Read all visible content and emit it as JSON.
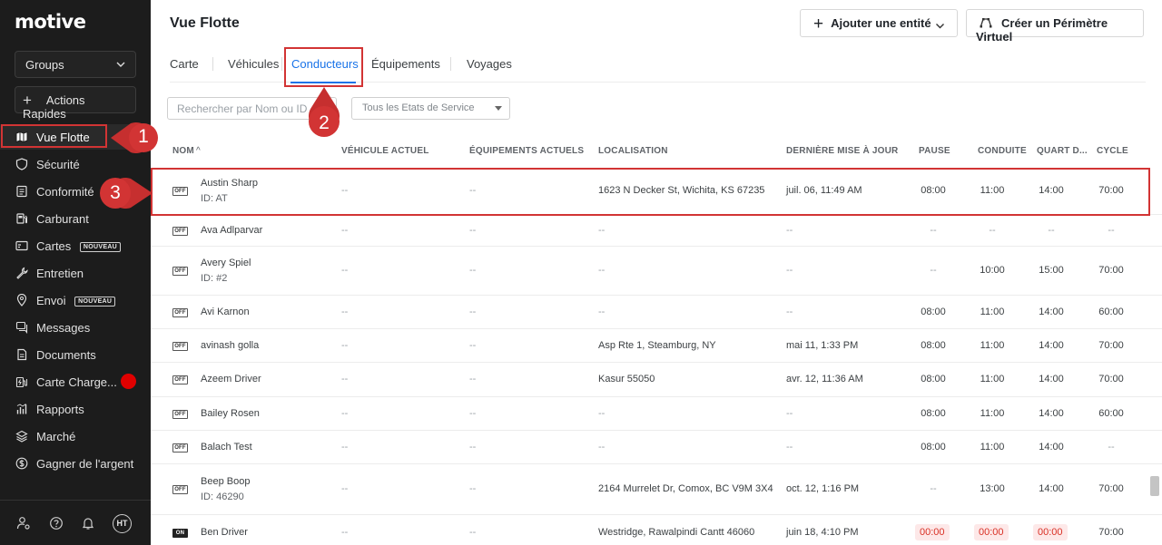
{
  "sidebar": {
    "logo": "motive",
    "groups_label": "Groups",
    "quick_actions_label": "Actions Rapides",
    "items": [
      {
        "label": "Vue Flotte",
        "icon": "map-icon",
        "active": true
      },
      {
        "label": "Sécurité",
        "icon": "shield-icon"
      },
      {
        "label": "Conformité",
        "icon": "document-list-icon"
      },
      {
        "label": "Carburant",
        "icon": "fuel-pump-icon"
      },
      {
        "label": "Cartes",
        "icon": "card-icon",
        "badge": "NOUVEAU"
      },
      {
        "label": "Entretien",
        "icon": "wrench-icon"
      },
      {
        "label": "Envoi",
        "icon": "location-pin-icon",
        "badge": "NOUVEAU"
      },
      {
        "label": "Messages",
        "icon": "chat-icon"
      },
      {
        "label": "Documents",
        "icon": "file-icon"
      },
      {
        "label": "Carte Charge...",
        "icon": "ev-charger-icon"
      },
      {
        "label": "Rapports",
        "icon": "bar-chart-icon"
      },
      {
        "label": "Marché",
        "icon": "layers-icon"
      },
      {
        "label": "Gagner de l'argent",
        "icon": "dollar-icon"
      }
    ],
    "avatar_initials": "HT"
  },
  "header": {
    "title": "Vue Flotte",
    "add_entity_label": "Ajouter une entité",
    "create_geofence_label": "Créer un Périmètre Virtuel"
  },
  "tabs": [
    {
      "label": "Carte"
    },
    {
      "label": "Véhicules"
    },
    {
      "label": "Conducteurs",
      "active": true
    },
    {
      "label": "Équipements"
    },
    {
      "label": "Voyages"
    }
  ],
  "filters": {
    "search_placeholder": "Rechercher par Nom ou ID",
    "service_state_value": "Tous les Etats de Service"
  },
  "table": {
    "columns": [
      "NOM",
      "VÉHICULE ACTUEL",
      "ÉQUIPEMENTS ACTUELS",
      "LOCALISATION",
      "DERNIÈRE MISE À JOUR",
      "PAUSE",
      "CONDUITE",
      "QUART D...",
      "CYCLE"
    ],
    "sort_indicator": "^",
    "rows": [
      {
        "status": "OFF",
        "name": "Austin Sharp",
        "id": "ID: AT",
        "vehicle": "--",
        "equipment": "--",
        "location": "1623 N Decker St, Wichita, KS 67235",
        "updated": "juil. 06, 11:49 AM",
        "pause": "08:00",
        "drive": "11:00",
        "shift": "14:00",
        "cycle": "70:00"
      },
      {
        "status": "OFF",
        "name": "Ava Adlparvar",
        "id": "",
        "vehicle": "--",
        "equipment": "--",
        "location": "--",
        "updated": "--",
        "pause": "--",
        "drive": "--",
        "shift": "--",
        "cycle": "--"
      },
      {
        "status": "OFF",
        "name": "Avery Spiel",
        "id": "ID: #2",
        "vehicle": "--",
        "equipment": "--",
        "location": "--",
        "updated": "--",
        "pause": "--",
        "drive": "10:00",
        "shift": "15:00",
        "cycle": "70:00"
      },
      {
        "status": "OFF",
        "name": "Avi Karnon",
        "id": "",
        "vehicle": "--",
        "equipment": "--",
        "location": "--",
        "updated": "--",
        "pause": "08:00",
        "drive": "11:00",
        "shift": "14:00",
        "cycle": "60:00"
      },
      {
        "status": "OFF",
        "name": "avinash golla",
        "id": "",
        "vehicle": "--",
        "equipment": "--",
        "location": "Asp Rte 1, Steamburg, NY",
        "updated": "mai 11, 1:33 PM",
        "pause": "08:00",
        "drive": "11:00",
        "shift": "14:00",
        "cycle": "70:00"
      },
      {
        "status": "OFF",
        "name": "Azeem Driver",
        "id": "",
        "vehicle": "--",
        "equipment": "--",
        "location": "Kasur 55050",
        "updated": "avr. 12, 11:36 AM",
        "pause": "08:00",
        "drive": "11:00",
        "shift": "14:00",
        "cycle": "70:00"
      },
      {
        "status": "OFF",
        "name": "Bailey Rosen",
        "id": "",
        "vehicle": "--",
        "equipment": "--",
        "location": "--",
        "updated": "--",
        "pause": "08:00",
        "drive": "11:00",
        "shift": "14:00",
        "cycle": "60:00"
      },
      {
        "status": "OFF",
        "name": "Balach Test",
        "id": "",
        "vehicle": "--",
        "equipment": "--",
        "location": "--",
        "updated": "--",
        "pause": "08:00",
        "drive": "11:00",
        "shift": "14:00",
        "cycle": "--"
      },
      {
        "status": "OFF",
        "name": "Beep Boop",
        "id": "ID: 46290",
        "vehicle": "--",
        "equipment": "--",
        "location": "2164 Murrelet Dr, Comox, BC V9M 3X4",
        "updated": "oct. 12, 1:16 PM",
        "pause": "--",
        "drive": "13:00",
        "shift": "14:00",
        "cycle": "70:00"
      },
      {
        "status": "ON",
        "name": "Ben Driver",
        "id": "",
        "vehicle": "--",
        "equipment": "--",
        "location": "Westridge, Rawalpindi Cantt 46060",
        "updated": "juin 18, 4:10 PM",
        "pause": "00:00",
        "drive": "00:00",
        "shift": "00:00",
        "cycle": "70:00",
        "violation": true
      }
    ]
  },
  "annotations": [
    {
      "number": "1"
    },
    {
      "number": "2"
    },
    {
      "number": "3"
    }
  ],
  "colors": {
    "sidebar_bg": "#1c1c1c",
    "accent": "#1973e8",
    "annotation_red": "#d23434",
    "violation_red": "#d93025"
  }
}
